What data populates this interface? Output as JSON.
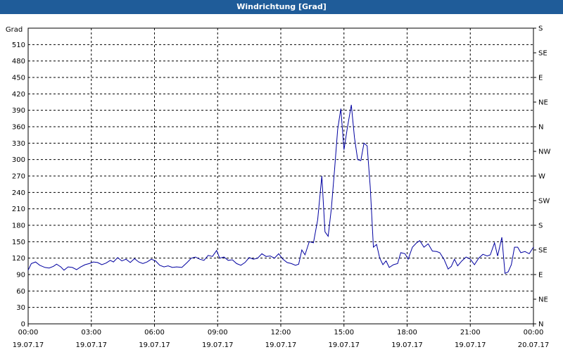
{
  "window": {
    "title": "Windrichtung [Grad]"
  },
  "chart_data": {
    "type": "line",
    "title": "Windrichtung [Grad]",
    "ylabel": "Grad",
    "xlabel": "",
    "ylim": [
      0,
      540
    ],
    "xlim_hours": [
      0,
      24
    ],
    "grid": true,
    "y_ticks": [
      0,
      30,
      60,
      90,
      120,
      150,
      180,
      210,
      240,
      270,
      300,
      330,
      360,
      390,
      420,
      450,
      480,
      510
    ],
    "right_ticks": [
      {
        "value": 0,
        "label": "N"
      },
      {
        "value": 45,
        "label": "NE"
      },
      {
        "value": 90,
        "label": "E"
      },
      {
        "value": 135,
        "label": "SE"
      },
      {
        "value": 180,
        "label": "S"
      },
      {
        "value": 225,
        "label": "SW"
      },
      {
        "value": 270,
        "label": "W"
      },
      {
        "value": 315,
        "label": "NW"
      },
      {
        "value": 360,
        "label": "N"
      },
      {
        "value": 405,
        "label": "NE"
      },
      {
        "value": 450,
        "label": "E"
      },
      {
        "value": 495,
        "label": "SE"
      },
      {
        "value": 540,
        "label": "S"
      }
    ],
    "x_ticks": [
      {
        "hour": 0,
        "time": "00:00",
        "date": "19.07.17"
      },
      {
        "hour": 3,
        "time": "03:00",
        "date": "19.07.17"
      },
      {
        "hour": 6,
        "time": "06:00",
        "date": "19.07.17"
      },
      {
        "hour": 9,
        "time": "09:00",
        "date": "19.07.17"
      },
      {
        "hour": 12,
        "time": "12:00",
        "date": "19.07.17"
      },
      {
        "hour": 15,
        "time": "15:00",
        "date": "19.07.17"
      },
      {
        "hour": 18,
        "time": "18:00",
        "date": "19.07.17"
      },
      {
        "hour": 21,
        "time": "21:00",
        "date": "19.07.17"
      },
      {
        "hour": 24,
        "time": "00:00",
        "date": "20.07.17"
      }
    ],
    "series": [
      {
        "color": "#0000a0",
        "points": [
          [
            0.0,
            98
          ],
          [
            0.15,
            110
          ],
          [
            0.35,
            113
          ],
          [
            0.55,
            107
          ],
          [
            0.8,
            103
          ],
          [
            1.0,
            102
          ],
          [
            1.2,
            105
          ],
          [
            1.35,
            109
          ],
          [
            1.55,
            104
          ],
          [
            1.7,
            98
          ],
          [
            1.9,
            104
          ],
          [
            2.1,
            103
          ],
          [
            2.3,
            99
          ],
          [
            2.5,
            104
          ],
          [
            2.7,
            108
          ],
          [
            2.9,
            110
          ],
          [
            3.1,
            113
          ],
          [
            3.3,
            112
          ],
          [
            3.5,
            108
          ],
          [
            3.7,
            111
          ],
          [
            3.9,
            116
          ],
          [
            4.05,
            113
          ],
          [
            4.25,
            121
          ],
          [
            4.45,
            115
          ],
          [
            4.65,
            118
          ],
          [
            4.85,
            112
          ],
          [
            5.05,
            119
          ],
          [
            5.25,
            113
          ],
          [
            5.45,
            110
          ],
          [
            5.65,
            113
          ],
          [
            5.85,
            118
          ],
          [
            6.05,
            115
          ],
          [
            6.25,
            107
          ],
          [
            6.45,
            104
          ],
          [
            6.65,
            106
          ],
          [
            6.85,
            103
          ],
          [
            7.05,
            104
          ],
          [
            7.3,
            103
          ],
          [
            7.55,
            112
          ],
          [
            7.75,
            120
          ],
          [
            7.95,
            122
          ],
          [
            8.15,
            118
          ],
          [
            8.35,
            116
          ],
          [
            8.55,
            125
          ],
          [
            8.75,
            123
          ],
          [
            8.95,
            134
          ],
          [
            9.1,
            120
          ],
          [
            9.3,
            122
          ],
          [
            9.5,
            116
          ],
          [
            9.7,
            117
          ],
          [
            9.9,
            110
          ],
          [
            10.1,
            107
          ],
          [
            10.3,
            112
          ],
          [
            10.5,
            121
          ],
          [
            10.7,
            118
          ],
          [
            10.9,
            120
          ],
          [
            11.1,
            128
          ],
          [
            11.3,
            123
          ],
          [
            11.5,
            124
          ],
          [
            11.7,
            120
          ],
          [
            11.9,
            128
          ],
          [
            12.1,
            118
          ],
          [
            12.3,
            112
          ],
          [
            12.5,
            110
          ],
          [
            12.7,
            107
          ],
          [
            12.85,
            109
          ],
          [
            13.0,
            135
          ],
          [
            13.15,
            126
          ],
          [
            13.35,
            150
          ],
          [
            13.55,
            148
          ],
          [
            13.75,
            190
          ],
          [
            13.95,
            270
          ],
          [
            14.1,
            168
          ],
          [
            14.25,
            160
          ],
          [
            14.4,
            210
          ],
          [
            14.55,
            280
          ],
          [
            14.7,
            355
          ],
          [
            14.85,
            393
          ],
          [
            15.0,
            318
          ],
          [
            15.15,
            355
          ],
          [
            15.35,
            400
          ],
          [
            15.5,
            340
          ],
          [
            15.65,
            300
          ],
          [
            15.8,
            298
          ],
          [
            15.95,
            330
          ],
          [
            16.1,
            325
          ],
          [
            16.25,
            250
          ],
          [
            16.4,
            140
          ],
          [
            16.55,
            145
          ],
          [
            16.7,
            120
          ],
          [
            16.85,
            108
          ],
          [
            17.0,
            115
          ],
          [
            17.15,
            103
          ],
          [
            17.35,
            108
          ],
          [
            17.55,
            110
          ],
          [
            17.7,
            130
          ],
          [
            17.9,
            128
          ],
          [
            18.05,
            118
          ],
          [
            18.25,
            140
          ],
          [
            18.45,
            148
          ],
          [
            18.6,
            152
          ],
          [
            18.8,
            140
          ],
          [
            19.0,
            146
          ],
          [
            19.2,
            133
          ],
          [
            19.4,
            132
          ],
          [
            19.55,
            130
          ],
          [
            19.75,
            118
          ],
          [
            19.95,
            100
          ],
          [
            20.1,
            105
          ],
          [
            20.25,
            118
          ],
          [
            20.4,
            106
          ],
          [
            20.6,
            115
          ],
          [
            20.8,
            122
          ],
          [
            21.0,
            118
          ],
          [
            21.2,
            108
          ],
          [
            21.4,
            120
          ],
          [
            21.6,
            127
          ],
          [
            21.8,
            124
          ],
          [
            21.95,
            126
          ],
          [
            22.15,
            148
          ],
          [
            22.3,
            124
          ],
          [
            22.5,
            158
          ],
          [
            22.65,
            92
          ],
          [
            22.8,
            95
          ],
          [
            22.95,
            108
          ],
          [
            23.1,
            140
          ],
          [
            23.25,
            140
          ],
          [
            23.4,
            130
          ],
          [
            23.6,
            132
          ],
          [
            23.8,
            128
          ],
          [
            24.0,
            140
          ]
        ]
      }
    ]
  }
}
